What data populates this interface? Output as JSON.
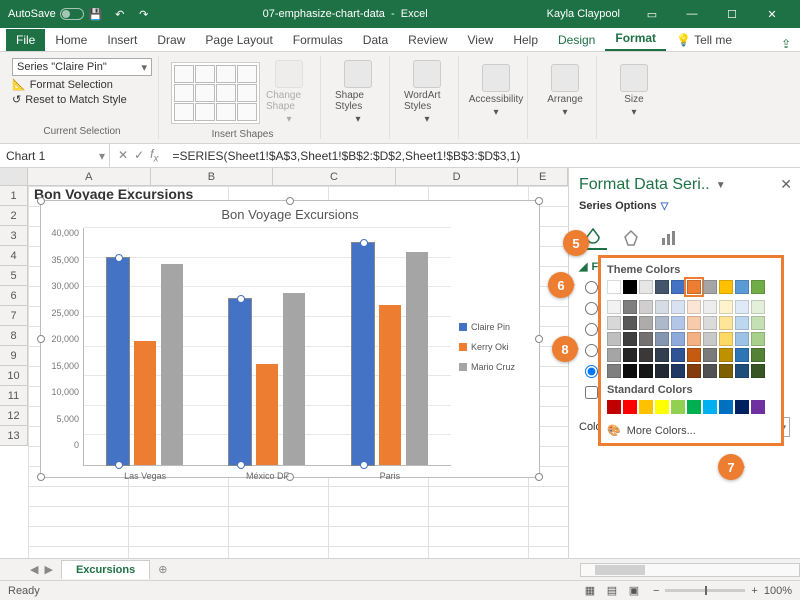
{
  "titlebar": {
    "autosave": "AutoSave",
    "filename": "07-emphasize-chart-data",
    "appname": "Excel",
    "user": "Kayla Claypool"
  },
  "tabs": {
    "file": "File",
    "home": "Home",
    "insert": "Insert",
    "draw": "Draw",
    "pagelayout": "Page Layout",
    "formulas": "Formulas",
    "data": "Data",
    "review": "Review",
    "view": "View",
    "help": "Help",
    "design": "Design",
    "format": "Format",
    "tellme": "Tell me"
  },
  "ribbon": {
    "series_dd": "Series \"Claire Pin\"",
    "format_selection": "Format Selection",
    "reset_match": "Reset to Match Style",
    "group_sel": "Current Selection",
    "group_shapes": "Insert Shapes",
    "change_shape": "Change Shape",
    "shape_styles": "Shape Styles",
    "wordart": "WordArt Styles",
    "accessibility": "Accessibility",
    "arrange": "Arrange",
    "size": "Size"
  },
  "namebox": "Chart 1",
  "formula": "=SERIES(Sheet1!$A$3,Sheet1!$B$2:$D$2,Sheet1!$B$3:$D$3,1)",
  "columns": [
    "A",
    "B",
    "C",
    "D",
    "E"
  ],
  "rows": [
    "1",
    "2",
    "3",
    "4",
    "5",
    "6",
    "7",
    "8",
    "9",
    "10",
    "11",
    "12",
    "13"
  ],
  "chart_overtitle": "Bon Voyage Excursions",
  "chart_data": {
    "type": "bar",
    "title": "Bon Voyage Excursions",
    "categories": [
      "Las Vegas",
      "México DF",
      "Paris"
    ],
    "series": [
      {
        "name": "Claire Pin",
        "color": "#4472C4",
        "values": [
          35000,
          28000,
          37500
        ]
      },
      {
        "name": "Kerry Oki",
        "color": "#ED7D31",
        "values": [
          21000,
          17000,
          27000
        ]
      },
      {
        "name": "Mario Cruz",
        "color": "#A5A5A5",
        "values": [
          34000,
          29000,
          36000
        ]
      }
    ],
    "ylim": [
      0,
      40000
    ],
    "yticks": [
      "40,000",
      "35,000",
      "30,000",
      "25,000",
      "20,000",
      "15,000",
      "10,000",
      "5,000",
      "0"
    ],
    "xlabel": "",
    "ylabel": ""
  },
  "pane": {
    "title": "Format Data Seri..",
    "subtitle": "Series Options",
    "fill": "Fill",
    "color_label": "Color"
  },
  "colorpicker": {
    "theme": "Theme Colors",
    "standard": "Standard Colors",
    "more": "More Colors...",
    "theme_row0": [
      "#FFFFFF",
      "#000000",
      "#E7E6E6",
      "#44546A",
      "#4472C4",
      "#ED7D31",
      "#A5A5A5",
      "#FFC000",
      "#5B9BD5",
      "#70AD47"
    ],
    "theme_shades": [
      [
        "#F2F2F2",
        "#7F7F7F",
        "#D0CECE",
        "#D6DCE4",
        "#D9E2F3",
        "#FBE5D5",
        "#EDEDED",
        "#FFF2CC",
        "#DEEBF6",
        "#E2EFD9"
      ],
      [
        "#D8D8D8",
        "#595959",
        "#AEABAB",
        "#ADB9CA",
        "#B4C6E7",
        "#F7CBAC",
        "#DBDBDB",
        "#FEE599",
        "#BDD7EE",
        "#C5E0B3"
      ],
      [
        "#BFBFBF",
        "#3F3F3F",
        "#757070",
        "#8496B0",
        "#8EAADB",
        "#F4B183",
        "#C9C9C9",
        "#FFD965",
        "#9CC3E5",
        "#A8D08D"
      ],
      [
        "#A5A5A5",
        "#262626",
        "#3A3838",
        "#323F4F",
        "#2F5496",
        "#C55A11",
        "#7B7B7B",
        "#BF9000",
        "#2E75B5",
        "#538135"
      ],
      [
        "#7F7F7F",
        "#0C0C0C",
        "#171616",
        "#222A35",
        "#1F3864",
        "#833C0B",
        "#525252",
        "#7F6000",
        "#1E4E79",
        "#375623"
      ]
    ],
    "standard_colors": [
      "#C00000",
      "#FF0000",
      "#FFC000",
      "#FFFF00",
      "#92D050",
      "#00B050",
      "#00B0F0",
      "#0070C0",
      "#002060",
      "#7030A0"
    ]
  },
  "callouts": {
    "c5": "5",
    "c6": "6",
    "c7": "7",
    "c8": "8"
  },
  "sheettab": "Excursions",
  "status": {
    "ready": "Ready",
    "zoom": "100%"
  }
}
